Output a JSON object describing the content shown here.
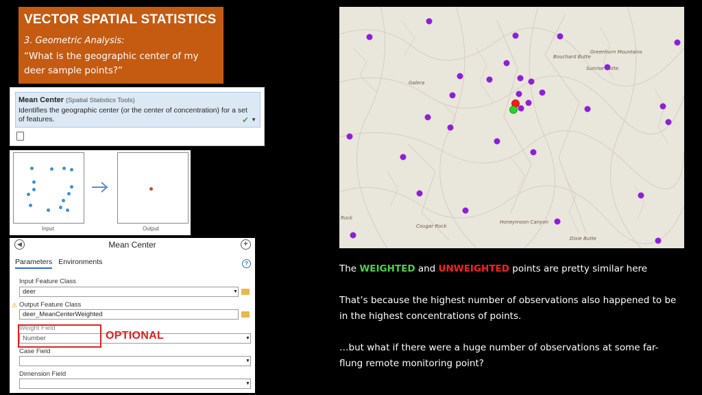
{
  "title_box": {
    "title": "VECTOR SPATIAL STATISTICS",
    "subtitle": "3. Geometric Analysis:",
    "question": "“What is the geographic center of my deer sample points?”"
  },
  "tool_header": {
    "name": "Mean Center",
    "toolbox": "(Spatial Statistics Tools)",
    "description": "Identifies the geographic center (or the center of concentration) for a set of features."
  },
  "diagram": {
    "input_caption": "Input",
    "output_caption": "Output"
  },
  "tool_pane": {
    "title": "Mean Center",
    "tabs": [
      {
        "label": "Parameters",
        "active": true
      },
      {
        "label": "Environments",
        "active": false
      }
    ],
    "input_feature_class": {
      "label": "Input Feature Class",
      "value": "deer"
    },
    "output_feature_class": {
      "label": "Output Feature Class",
      "value": "deer_MeanCenterWeighted"
    },
    "weight_field": {
      "label": "Weight Field",
      "value": "Number"
    },
    "case_field": {
      "label": "Case Field",
      "value": ""
    },
    "dimension_field": {
      "label": "Dimension Field",
      "value": ""
    }
  },
  "optional_label": "OPTIONAL",
  "map": {
    "labels": [
      "Galera",
      "Bouchard Butte",
      "Greenhorn Mountains",
      "Sunrise Butte",
      "Cougar Rock",
      "Honeymoon Canyon",
      "Rock",
      "Dixie Butte"
    ],
    "colors": {
      "deer_points": "#8e1fd8",
      "unweighted_center": "#ff1a1a",
      "weighted_center": "#2ad12a",
      "terrain": "#e9e6dc"
    }
  },
  "commentary": {
    "p1_prefix": "The ",
    "p1_weighted": "WEIGHTED",
    "p1_mid": " and ",
    "p1_unweighted": "UNWEIGHTED",
    "p1_suffix": " points are pretty similar here",
    "p2": "That’s because the highest number of observations also happened to be in the highest concentrations of points.",
    "p3": "…but what if there were a huge number of observations at some far-flung remote monitoring point?"
  }
}
